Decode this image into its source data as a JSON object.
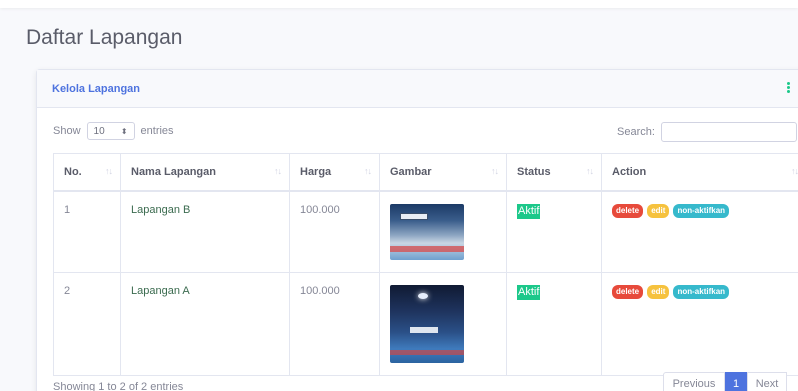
{
  "page": {
    "title": "Daftar Lapangan"
  },
  "card": {
    "title": "Kelola Lapangan"
  },
  "controls": {
    "show_label": "Show",
    "page_size": "10",
    "entries_label": "entries",
    "search_label": "Search:",
    "search_value": ""
  },
  "table": {
    "headers": [
      "No.",
      "Nama Lapangan",
      "Harga",
      "Gambar",
      "Status",
      "Action"
    ],
    "rows": [
      {
        "no": "1",
        "name": "Lapangan B",
        "price": "100.000",
        "status": "Aktif"
      },
      {
        "no": "2",
        "name": "Lapangan A",
        "price": "100.000",
        "status": "Aktif"
      }
    ],
    "actions": {
      "delete": "delete",
      "edit": "edit",
      "deactivate": "non-aktifkan"
    }
  },
  "footer": {
    "info": "Showing 1 to 2 of 2 entries"
  },
  "pagination": {
    "previous": "Previous",
    "current": "1",
    "next": "Next"
  },
  "colors": {
    "primary": "#4e73df",
    "success": "#1cc88a",
    "danger": "#e74a3b",
    "warning": "#f6c23e",
    "info": "#36b9cc"
  }
}
